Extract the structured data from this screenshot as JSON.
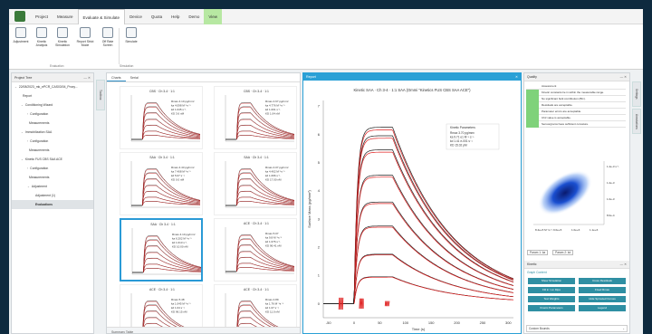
{
  "menu": {
    "items": [
      "Project",
      "Measure",
      "Evaluate & Simulate",
      "Device",
      "Quota",
      "Help",
      "Demo",
      "View"
    ],
    "active_index": 2
  },
  "ribbon": {
    "buttons": [
      "Adjustment",
      "Kinetic Analysis",
      "Kinetic Simulation",
      "Report Strict Mode",
      "Off Rate Screen",
      "Simulate"
    ],
    "groups": [
      "Evaluation",
      "Simulation"
    ]
  },
  "project_tree": {
    "title": "Project Tree",
    "nodes": [
      {
        "label": "22/08/2023_mk_ePCR_CAS03/04_Proxy...",
        "level": 0,
        "arrow": "⌄"
      },
      {
        "label": "Report",
        "level": 1,
        "arrow": ""
      },
      {
        "label": "Conditioning Wizard",
        "level": 1,
        "arrow": "⌄"
      },
      {
        "label": "Configuration",
        "level": 2,
        "arrow": "›"
      },
      {
        "label": "Measurements",
        "level": 2,
        "arrow": ""
      },
      {
        "label": "Immobilization SAA",
        "level": 1,
        "arrow": "⌄"
      },
      {
        "label": "Configuration",
        "level": 2,
        "arrow": "›"
      },
      {
        "label": "Measurements",
        "level": 2,
        "arrow": ""
      },
      {
        "label": "Kinetic FUS CBS SAA ACE",
        "level": 1,
        "arrow": "⌄"
      },
      {
        "label": "Configuration",
        "level": 2,
        "arrow": "›"
      },
      {
        "label": "Measurements",
        "level": 2,
        "arrow": ""
      },
      {
        "label": "Adjustment",
        "level": 2,
        "arrow": "⌄"
      },
      {
        "label": "Adjustment (1)",
        "level": 3,
        "arrow": ""
      },
      {
        "label": "Evaluations",
        "level": 3,
        "arrow": "",
        "selected": true
      }
    ]
  },
  "vertical_tab": "Toolbox",
  "grid": {
    "tabs": [
      "Charts",
      "Serial"
    ],
    "charts": [
      {
        "title": "CBS · Ch 3-4 · 1:1",
        "params": [
          "Rmax 4.10   pg/mm²",
          "ka  4.098  M⁻¹s⁻¹",
          "kd  1.045  s⁻¹",
          "KD  3.6  nM"
        ],
        "selected": false
      },
      {
        "title": "CBS · Ch 3-4 · 1:1",
        "params": [
          "Rmax 4.67   pg/mm²",
          "ka  4.776  M⁻¹s⁻¹",
          "kd  1.001  s⁻¹",
          "KD  1.04  nM"
        ],
        "selected": false
      },
      {
        "title": "SAA · Ch 3-4 · 1:1",
        "params": [
          "Rmax 4.43   pg/mm²",
          "ka  7.408  M⁻¹s⁻¹",
          "kd  5.07  s⁻¹",
          "KD  0.0  nM"
        ],
        "selected": false
      },
      {
        "title": "SAA · Ch 3-4 · 1:1",
        "params": [
          "Rmax 4.07   pg/mm²",
          "ka  4.402  M⁻¹s⁻¹",
          "kd  1.096  s⁻¹",
          "KD  17.00  nM"
        ],
        "selected": false
      },
      {
        "title": "SAA · Ch 3-4 · 1:1",
        "params": [
          "Rmax 4.10   pg/mm²",
          "ka  6.202  M⁻¹s⁻¹",
          "kd  1.013  s⁻¹",
          "KD  10.00  nM"
        ],
        "selected": true
      },
      {
        "title": "ACE · Ch 3-4 · 1:1",
        "params": [
          "Rmax 5.07",
          "ka  9.8 M⁻¹s⁻¹",
          "kd  1.076 s⁻¹",
          "KD  96.41 nM"
        ],
        "selected": false
      },
      {
        "title": "ACE · Ch 3-4 · 1:1",
        "params": [
          "Rmax 5.48",
          "ka  1.045 M⁻¹s⁻¹",
          "kd  1.04 s⁻¹",
          "KD  96.15 nM"
        ],
        "selected": false
      },
      {
        "title": "ACE · Ch 3-4 · 1:1",
        "params": [
          "Rmax 4.89",
          "ka  1.76 M⁻¹s⁻¹",
          "kd  1.07 s⁻¹",
          "KD  11.0 nM"
        ],
        "selected": false
      }
    ],
    "summary": "Summary Table"
  },
  "main_chart_panel": {
    "tab_title": "Report"
  },
  "chart_data": {
    "type": "line",
    "title": "Kinetic SAA · Ch 3-4 · 1:1 SAA (Ommi \"Kinetics FUS CBS SAA ACE\")",
    "xlabel": "Time (s)",
    "ylabel": "Surface Mass (pg/mm²)",
    "xlim": [
      -60,
      310
    ],
    "ylim": [
      -0.5,
      7.2
    ],
    "xticks": [
      -50,
      0,
      50,
      100,
      150,
      200,
      250,
      300
    ],
    "yticks": [
      0,
      1,
      2,
      3,
      4,
      5,
      6,
      7
    ],
    "params_box": {
      "title": "Kinetic Parameters",
      "rows": [
        "Rmax 3.70  pg/mm²",
        "ka  9.71 e1 M⁻¹ s⁻¹",
        "kd  1.41 e-001 s⁻¹",
        "KD  15.02  pM"
      ]
    },
    "association_start": 0,
    "dissociation_start": 75,
    "series": [
      {
        "plateau": 6.25
      },
      {
        "plateau": 5.95
      },
      {
        "plateau": 5.45
      },
      {
        "plateau": 4.55
      },
      {
        "plateau": 3.6
      },
      {
        "plateau": 2.75
      },
      {
        "plateau": 1.75
      },
      {
        "plateau": 0.95
      }
    ]
  },
  "quality": {
    "title": "Quality",
    "header": "Assessment",
    "rows": [
      "Kinetic constants lie in within the measurable range.",
      "No significant bulk contribution (BC).",
      "Residuals are acceptable.",
      "Parameter errors are acceptable.",
      "Chi² value is acceptable.",
      "Sensorgrams have sufficient curvature."
    ]
  },
  "correlation": {
    "y_labels": [
      "1.4e-3 s⁻¹",
      "1.2e-3",
      "1.0e-3",
      "8.0e-4"
    ],
    "x_labels": [
      "8.4e+5 M⁻¹s⁻¹",
      "9.0e+5",
      "1.0e+6",
      "1.1e+6"
    ],
    "param_x": "Param 1:  ka",
    "param_y": "Param 2:  kd"
  },
  "kinetic_tools": {
    "title": "Kinetic",
    "section": "Graph Content",
    "buttons": [
      "Show Simulation",
      "Cross Residuals",
      "Fill in / on Dips",
      "Fixed Rmax",
      "Text Weights",
      "Hide Sprouted Curves",
      "Kinetic Parameters",
      "Legend"
    ],
    "custom_bounds": "Custom Bounds"
  },
  "side_tabs": [
    "Settings",
    "Annotations"
  ]
}
